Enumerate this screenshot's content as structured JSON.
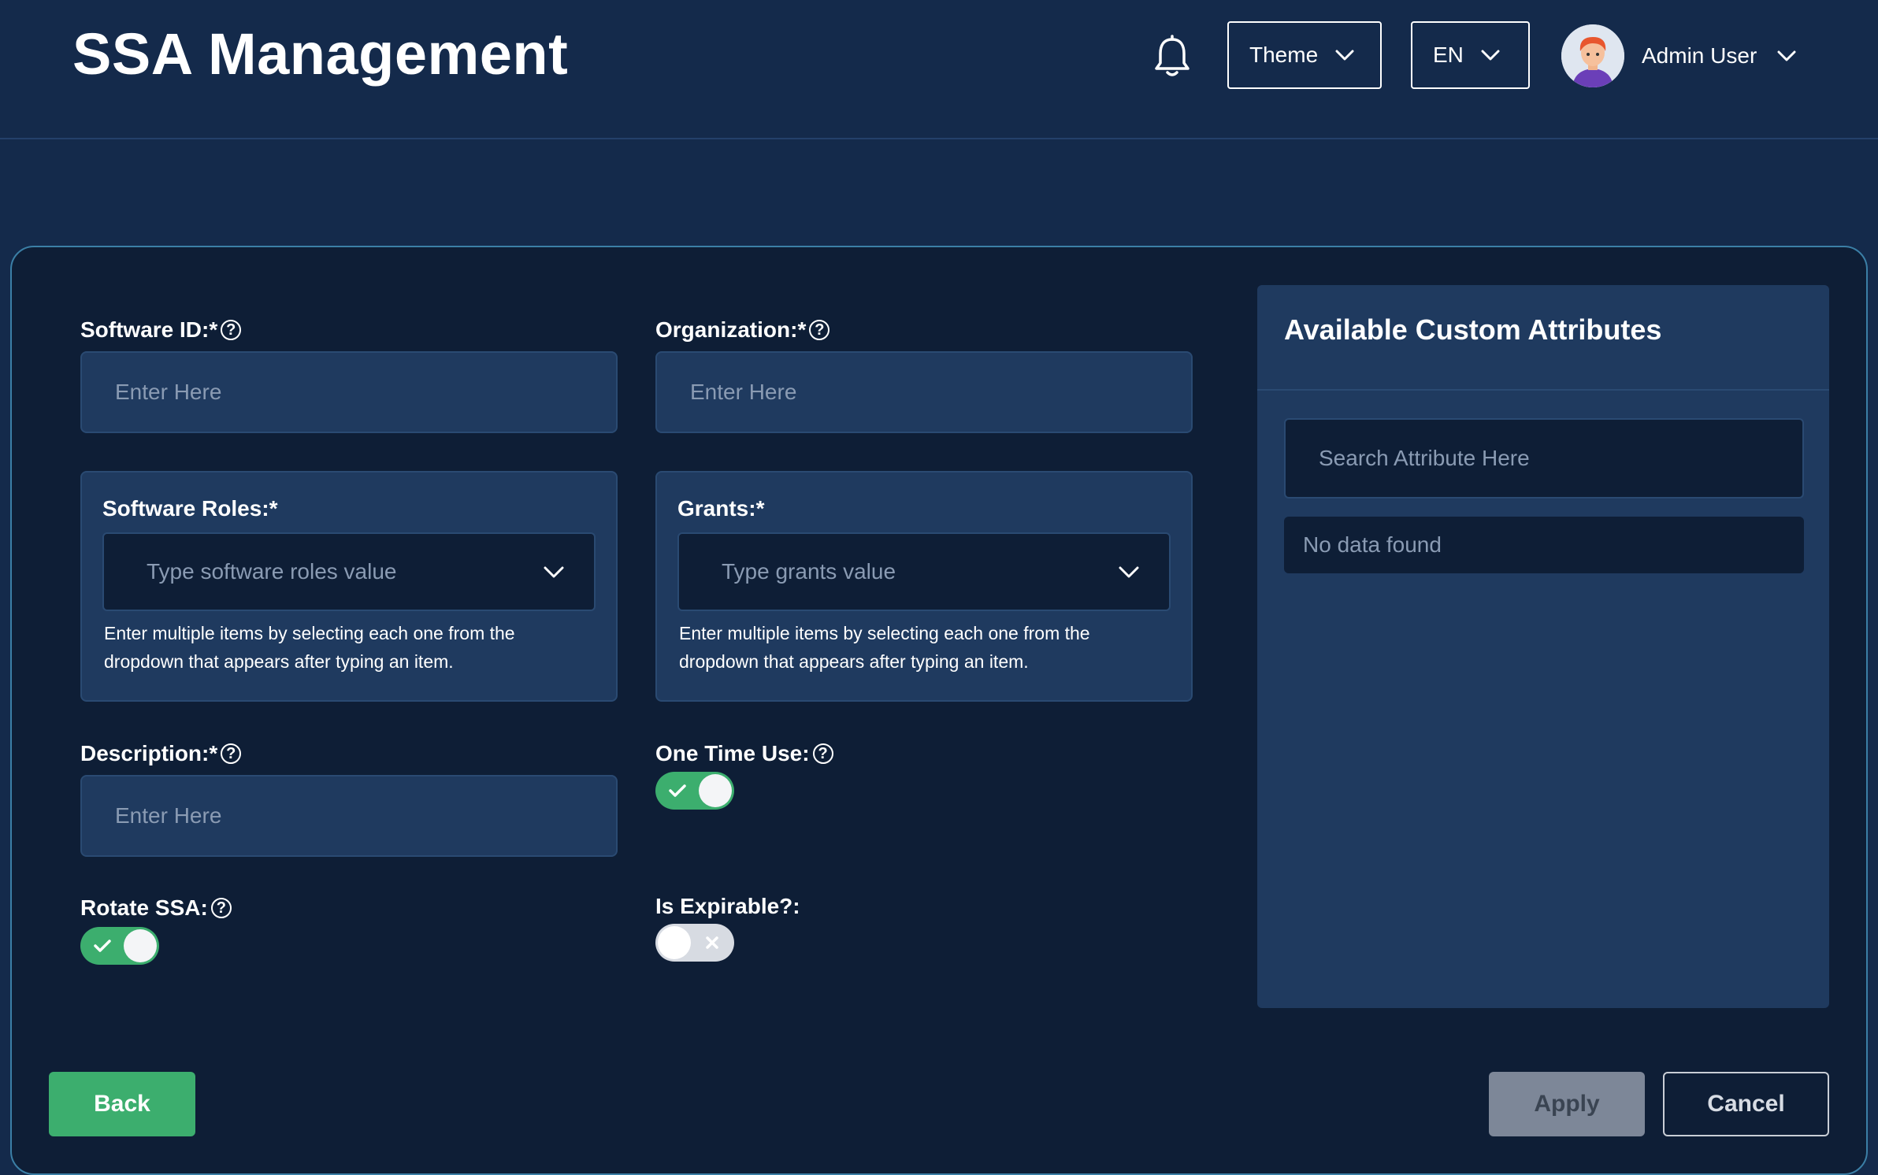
{
  "header": {
    "title": "SSA Management",
    "theme_label": "Theme",
    "language_label": "EN",
    "user_name": "Admin User"
  },
  "form": {
    "software_id": {
      "label": "Software ID:*",
      "placeholder": "Enter Here",
      "value": ""
    },
    "organization": {
      "label": "Organization:*",
      "placeholder": "Enter Here",
      "value": ""
    },
    "software_roles": {
      "label": "Software Roles:*",
      "placeholder": "Type software roles value",
      "help_line1": "Enter multiple items by selecting each one from the",
      "help_line2": "dropdown that appears after typing an item."
    },
    "grants": {
      "label": "Grants:*",
      "placeholder": "Type grants value",
      "help_line1": "Enter multiple items by selecting each one from the",
      "help_line2": "dropdown that appears after typing an item."
    },
    "description": {
      "label": "Description:*",
      "placeholder": "Enter Here",
      "value": ""
    },
    "one_time_use": {
      "label": "One Time Use:",
      "enabled": true
    },
    "rotate_ssa": {
      "label": "Rotate SSA:",
      "enabled": true
    },
    "is_expirable": {
      "label": "Is Expirable?:",
      "enabled": false
    }
  },
  "attributes_panel": {
    "title": "Available Custom Attributes",
    "search_placeholder": "Search Attribute Here",
    "empty_text": "No data found"
  },
  "buttons": {
    "back": "Back",
    "apply": "Apply",
    "cancel": "Cancel"
  },
  "icons": {
    "help": "?"
  },
  "colors": {
    "background": "#142a4b",
    "card": "#0e1e36",
    "field": "#1f3a5f",
    "accent_green": "#3cae6e",
    "card_border": "#3b7fa6",
    "apply_disabled": "#7d8798"
  }
}
